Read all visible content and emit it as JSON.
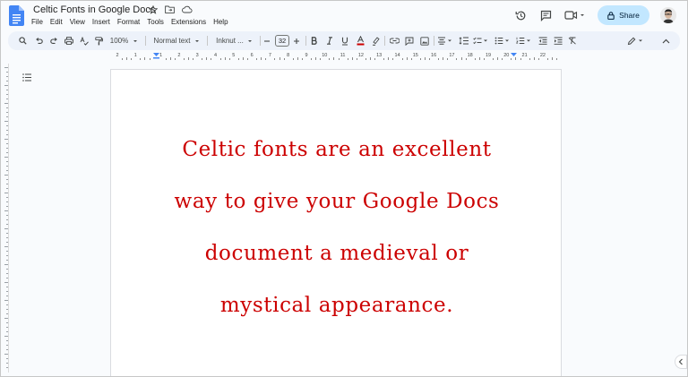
{
  "window": {
    "doc_title": "Celtic Fonts in Google Docs"
  },
  "menubar": {
    "items": [
      "File",
      "Edit",
      "View",
      "Insert",
      "Format",
      "Tools",
      "Extensions",
      "Help"
    ]
  },
  "header_actions": {
    "share_label": "Share"
  },
  "toolbar": {
    "zoom": "100%",
    "style": "Normal text",
    "font": "Inknut ...",
    "font_size": "32",
    "text_color": "#cc0000"
  },
  "ruler": {
    "numbers": [
      "2",
      "1",
      "1",
      "2",
      "3",
      "4",
      "5",
      "6",
      "7",
      "8",
      "9",
      "10",
      "11",
      "12",
      "13",
      "14",
      "15",
      "16",
      "17",
      "18",
      "19",
      "20",
      "21",
      "22"
    ]
  },
  "document": {
    "lines": [
      "Celtic fonts are an excellent",
      "way to give your Google Docs",
      "document a medieval or",
      "mystical appearance."
    ],
    "text_color": "#cc0000"
  },
  "icons": {
    "title": [
      "star-icon",
      "move-to-folder-icon",
      "cloud-status-icon"
    ],
    "header": [
      "history-icon",
      "comments-icon",
      "meet-icon"
    ],
    "toolbar": [
      "search-icon",
      "undo-icon",
      "redo-icon",
      "print-icon",
      "spellcheck-icon",
      "paint-format-icon",
      "bold-icon",
      "italic-icon",
      "underline-icon",
      "text-color-icon",
      "highlight-icon",
      "link-icon",
      "add-comment-icon",
      "insert-image-icon",
      "align-icon",
      "line-spacing-icon",
      "checklist-icon",
      "bulleted-list-icon",
      "numbered-list-icon",
      "decrease-indent-icon",
      "increase-indent-icon",
      "clear-formatting-icon",
      "editing-mode-icon",
      "collapse-icon"
    ]
  }
}
